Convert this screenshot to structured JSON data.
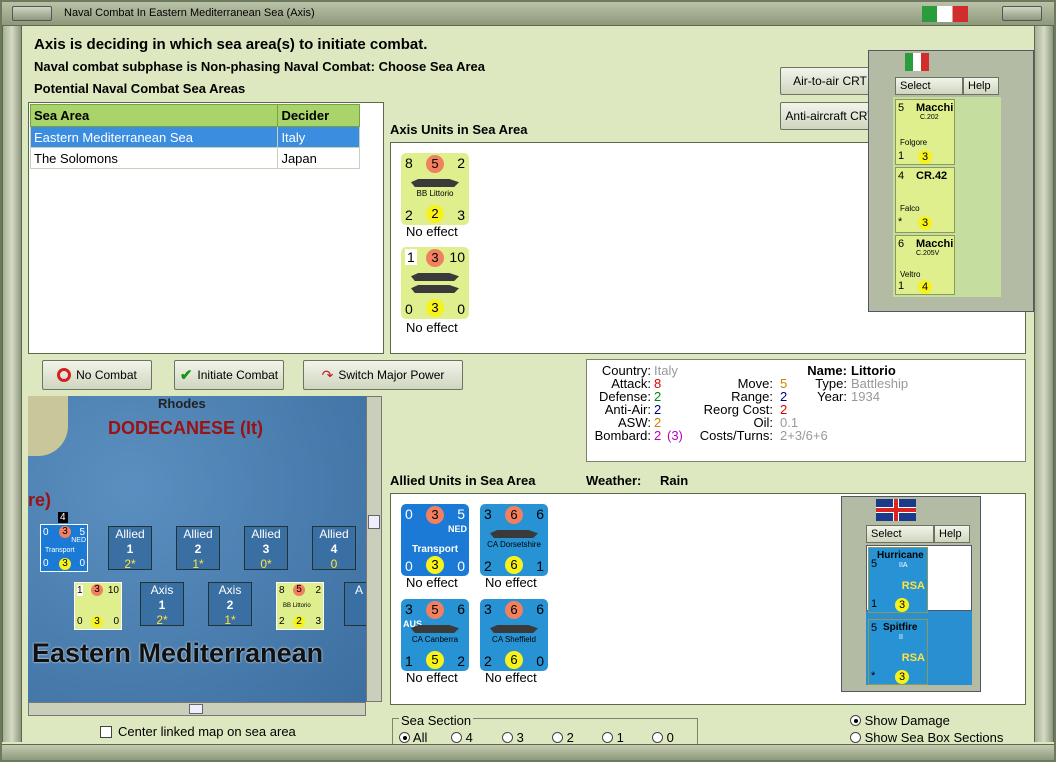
{
  "window": {
    "title": "Naval Combat In Eastern Mediterranean Sea (Axis)"
  },
  "header": {
    "line1": "Axis is deciding in which sea area(s) to initiate combat.",
    "line2": "Naval combat subphase is Non-phasing Naval Combat: Choose Sea Area",
    "line3": "Potential Naval Combat Sea Areas"
  },
  "sea_table": {
    "col1": "Sea Area",
    "col2": "Decider",
    "rows": [
      {
        "area": "Eastern Mediterranean Sea",
        "decider": "Italy"
      },
      {
        "area": "The Solomons",
        "decider": "Japan"
      }
    ]
  },
  "buttons": {
    "no_combat": "No Combat",
    "initiate": "Initiate Combat",
    "switch": "Switch Major Power",
    "air_crt": "Air-to-air CRT",
    "aa_crt": "Anti-aircraft CRT"
  },
  "axis_units": {
    "title": "Axis Units in Sea Area",
    "units": [
      {
        "tl": "8",
        "circle": "5",
        "tr": "2",
        "name": "BB Littorio",
        "bl": "2",
        "ycircle": "2",
        "br": "3",
        "result": "No effect"
      },
      {
        "tl": "1",
        "circle": "3",
        "tr": "10",
        "name": "",
        "bl": "0",
        "ycircle": "3",
        "br": "0",
        "result": "No effect"
      }
    ]
  },
  "axis_air": {
    "select": "Select",
    "help": "Help",
    "planes": [
      {
        "top": "5",
        "name": "Macchi",
        "sub": "C.202",
        "pilot": "Folgore",
        "b1": "1",
        "b2": "3"
      },
      {
        "top": "4",
        "name": "CR.42",
        "sub": "",
        "pilot": "Falco",
        "b1": "*",
        "b2": "3"
      },
      {
        "top": "6",
        "name": "Macchi",
        "sub": "C.205V",
        "pilot": "Veltro",
        "b1": "1",
        "b2": "4"
      }
    ]
  },
  "info": {
    "country_l": "Country:",
    "country": "Italy",
    "attack_l": "Attack:",
    "attack": "8",
    "defense_l": "Defense:",
    "defense": "2",
    "aa_l": "Anti-Air:",
    "aa": "2",
    "asw_l": "ASW:",
    "asw": "2",
    "bombard_l": "Bombard:",
    "bombard": "2",
    "bombard2": "(3)",
    "move_l": "Move:",
    "move": "5",
    "range_l": "Range:",
    "range": "2",
    "reorg_l": "Reorg Cost:",
    "reorg": "2",
    "oil_l": "Oil:",
    "oil": "0.1",
    "costs_l": "Costs/Turns:",
    "costs": "2+3/6+6",
    "name_l": "Name:",
    "name": "Littorio",
    "type_l": "Type:",
    "type": "Battleship",
    "year_l": "Year:",
    "year": "1934"
  },
  "allied_units": {
    "title": "Allied Units in Sea Area",
    "weather_label": "Weather:",
    "weather": "Rain",
    "units": [
      {
        "tl": "0",
        "circle": "3",
        "tr": "5",
        "name": "Transport",
        "tag": "NED",
        "bl": "0",
        "ycircle": "3",
        "br": "0",
        "result": "No effect"
      },
      {
        "tl": "3",
        "circle": "6",
        "tr": "6",
        "name": "CA Dorsetshire",
        "tag": "",
        "bl": "2",
        "ycircle": "6",
        "br": "1",
        "result": "No effect"
      },
      {
        "tl": "3",
        "circle": "5",
        "tr": "6",
        "name": "CA Canberra",
        "tag": "AUS",
        "bl": "1",
        "ycircle": "5",
        "br": "2",
        "result": "No effect"
      },
      {
        "tl": "3",
        "circle": "6",
        "tr": "6",
        "name": "CA Sheffield",
        "tag": "",
        "bl": "2",
        "ycircle": "6",
        "br": "0",
        "result": "No effect"
      }
    ]
  },
  "allied_air": {
    "select": "Select",
    "help": "Help",
    "planes": [
      {
        "top": "5",
        "name": "Hurricane",
        "sub": "IIA",
        "tag": "RSA",
        "b1": "1",
        "b2": "3"
      },
      {
        "top": "5",
        "name": "Spitfire",
        "sub": "II",
        "tag": "RSA",
        "b1": "*",
        "b2": "3"
      }
    ]
  },
  "map": {
    "rhodes": "Rhodes",
    "dodecanese": "DODECANESE (It)",
    "re": "re)",
    "sea": "Eastern Mediterranean",
    "allied_boxes": [
      {
        "a": "Allied",
        "n": "1",
        "m": "2*"
      },
      {
        "a": "Allied",
        "n": "2",
        "m": "1*"
      },
      {
        "a": "Allied",
        "n": "3",
        "m": "0*"
      },
      {
        "a": "Allied",
        "n": "4",
        "m": "0"
      }
    ],
    "axis_boxes": [
      {
        "a": "Axis",
        "n": "1",
        "m": "2*"
      },
      {
        "a": "Axis",
        "n": "2",
        "m": "1*"
      },
      {
        "a": "A"
      }
    ],
    "counter1": {
      "tl": "0",
      "c": "3",
      "tr": "5",
      "tag": "NED",
      "name": "Transport",
      "bl": "0",
      "y": "3",
      "br": "0",
      "badge": "4"
    },
    "counter2": {
      "tl": "1",
      "c": "3",
      "tr": "10",
      "bl": "0",
      "y": "3",
      "br": "0"
    },
    "counter3": {
      "tl": "8",
      "c": "5",
      "tr": "2",
      "name": "BB Littorio",
      "bl": "2",
      "y": "2",
      "br": "3"
    }
  },
  "center_map": "Center linked map on sea area",
  "sea_section": {
    "label": "Sea Section",
    "options": [
      "All",
      "4",
      "3",
      "2",
      "1",
      "0"
    ]
  },
  "show": {
    "damage": "Show Damage",
    "sections": "Show Sea Box Sections"
  }
}
